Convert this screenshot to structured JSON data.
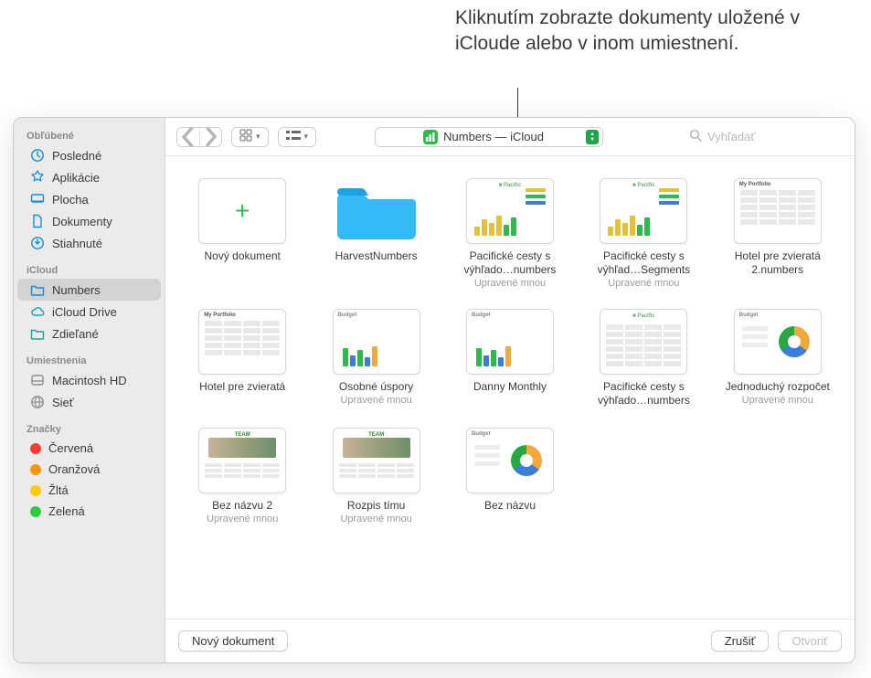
{
  "callout": "Kliknutím zobrazte dokumenty uložené v iCloude alebo v inom umiestnení.",
  "sidebar": {
    "sections": [
      {
        "heading": "Obľúbené",
        "items": [
          {
            "label": "Posledné",
            "icon": "clock",
            "color": "#0f8edb"
          },
          {
            "label": "Aplikácie",
            "icon": "apps",
            "color": "#0f8edb"
          },
          {
            "label": "Plocha",
            "icon": "desktop",
            "color": "#0f8edb"
          },
          {
            "label": "Dokumenty",
            "icon": "doc",
            "color": "#0f8edb"
          },
          {
            "label": "Stiahnuté",
            "icon": "download",
            "color": "#0f8edb"
          }
        ]
      },
      {
        "heading": "iCloud",
        "items": [
          {
            "label": "Numbers",
            "icon": "folder",
            "color": "#0f8edb",
            "selected": true
          },
          {
            "label": "iCloud Drive",
            "icon": "cloud",
            "color": "#1aa3a3"
          },
          {
            "label": "Zdieľané",
            "icon": "shared",
            "color": "#1aa3a3"
          }
        ]
      },
      {
        "heading": "Umiestnenia",
        "items": [
          {
            "label": "Macintosh HD",
            "icon": "disk",
            "color": "#8e8e8e"
          },
          {
            "label": "Sieť",
            "icon": "network",
            "color": "#8e8e8e"
          }
        ]
      },
      {
        "heading": "Značky",
        "items": [
          {
            "label": "Červená",
            "icon": "tag",
            "color": "#ff3b30"
          },
          {
            "label": "Oranžová",
            "icon": "tag",
            "color": "#ff9500"
          },
          {
            "label": "Žltá",
            "icon": "tag",
            "color": "#ffcc00"
          },
          {
            "label": "Zelená",
            "icon": "tag",
            "color": "#28cd41"
          }
        ]
      }
    ]
  },
  "toolbar": {
    "location": "Numbers — iCloud",
    "search_placeholder": "Vyhľadať"
  },
  "grid": {
    "items": [
      {
        "name": "Nový dokument",
        "sub": "",
        "kind": "new"
      },
      {
        "name": "HarvestNumbers",
        "sub": "",
        "kind": "folder"
      },
      {
        "name": "Pacifické cesty s výhľado…numbers",
        "sub": "Upravené mnou",
        "kind": "chart-green"
      },
      {
        "name": "Pacifické cesty s výhľad…Segments",
        "sub": "Upravené mnou",
        "kind": "chart-green"
      },
      {
        "name": "Hotel pre zvieratá 2.numbers",
        "sub": "",
        "kind": "portfolio"
      },
      {
        "name": "Hotel pre zvieratá",
        "sub": "",
        "kind": "portfolio"
      },
      {
        "name": "Osobné úspory",
        "sub": "Upravené mnou",
        "kind": "bars-mixed"
      },
      {
        "name": "Danny Monthly",
        "sub": "",
        "kind": "bars-mixed"
      },
      {
        "name": "Pacifické cesty s výhľado…numbers",
        "sub": "",
        "kind": "table-green"
      },
      {
        "name": "Jednoduchý rozpočet",
        "sub": "Upravené mnou",
        "kind": "pie"
      },
      {
        "name": "Bez názvu 2",
        "sub": "Upravené mnou",
        "kind": "photo"
      },
      {
        "name": "Rozpis tímu",
        "sub": "Upravené mnou",
        "kind": "photo"
      },
      {
        "name": "Bez názvu",
        "sub": "",
        "kind": "pie"
      }
    ]
  },
  "footer": {
    "new_document": "Nový dokument",
    "cancel": "Zrušiť",
    "open": "Otvoriť"
  }
}
